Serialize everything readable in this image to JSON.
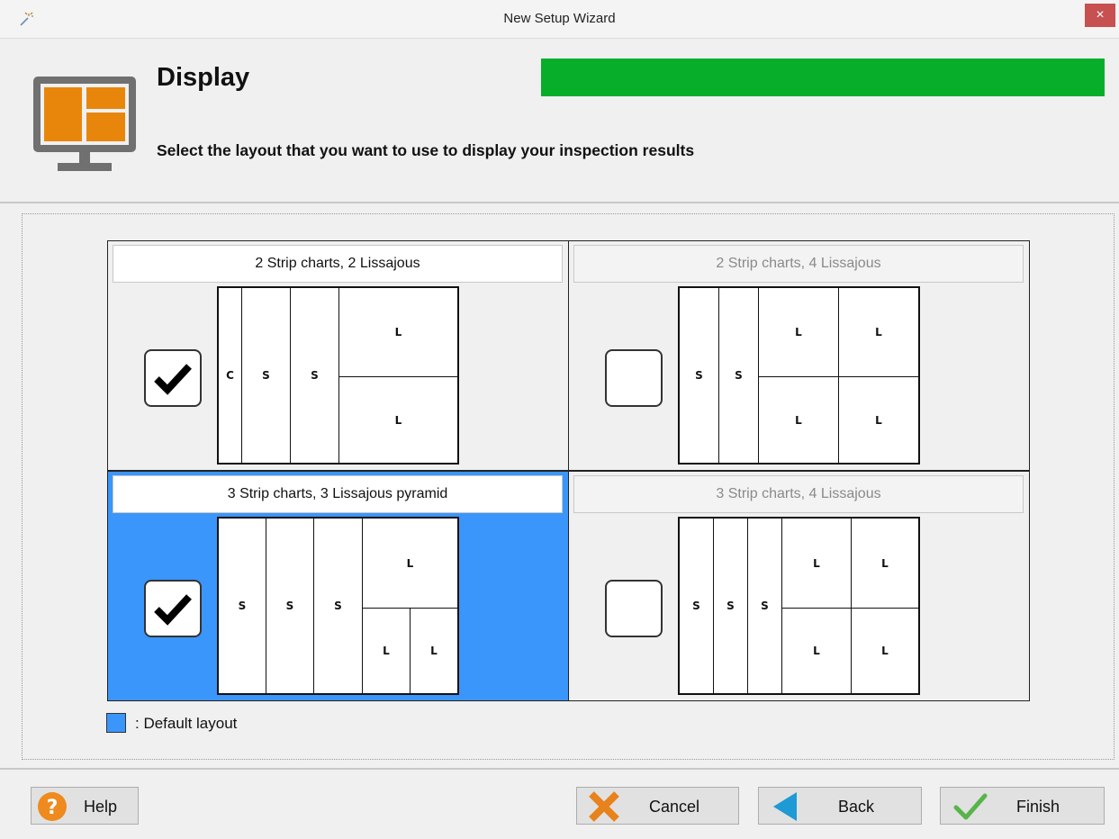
{
  "window": {
    "title": "New Setup Wizard",
    "close_glyph": "×"
  },
  "header": {
    "title": "Display",
    "subtitle": "Select the layout that you want to use to display your inspection results",
    "progress": 1.0,
    "progress_color": "#06ae2a"
  },
  "layouts": [
    {
      "label": "2 Strip charts, 2 Lissajous",
      "checked": true,
      "default": false,
      "dimmed": false,
      "panes": [
        "C",
        "S",
        "S",
        "L",
        "L"
      ]
    },
    {
      "label": "2 Strip charts, 4 Lissajous",
      "checked": false,
      "default": false,
      "dimmed": true,
      "panes": [
        "S",
        "S",
        "L",
        "L",
        "L",
        "L"
      ]
    },
    {
      "label": "3 Strip charts, 3 Lissajous pyramid",
      "checked": true,
      "default": true,
      "dimmed": false,
      "panes": [
        "S",
        "S",
        "S",
        "L",
        "L",
        "L"
      ]
    },
    {
      "label": "3 Strip charts, 4 Lissajous",
      "checked": false,
      "default": false,
      "dimmed": true,
      "panes": [
        "S",
        "S",
        "S",
        "L",
        "L",
        "L",
        "L"
      ]
    }
  ],
  "legend": {
    "text": ": Default layout",
    "color": "#3a96fb"
  },
  "buttons": {
    "help": "Help",
    "cancel": "Cancel",
    "back": "Back",
    "finish": "Finish"
  },
  "icons": {
    "app": "magic-wand-icon",
    "header": "monitor-layout-icon",
    "help": "question-circle-icon",
    "cancel": "x-icon",
    "back": "back-arrow-icon",
    "finish": "check-icon"
  }
}
